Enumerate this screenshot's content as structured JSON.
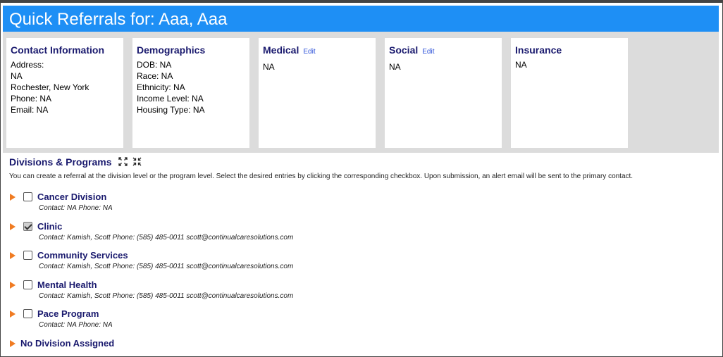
{
  "header": {
    "title": "Quick Referrals for: Aaa, Aaa"
  },
  "cards": {
    "contact": {
      "title": "Contact Information",
      "lines": [
        "Address:",
        "NA",
        "Rochester, New York",
        "Phone: NA",
        "Email: NA"
      ]
    },
    "demographics": {
      "title": "Demographics",
      "lines": [
        "DOB: NA",
        "Race: NA",
        "Ethnicity: NA",
        "Income Level: NA",
        "Housing Type: NA"
      ]
    },
    "medical": {
      "title": "Medical",
      "edit": "Edit",
      "lines": [
        "NA"
      ]
    },
    "social": {
      "title": "Social",
      "edit": "Edit",
      "lines": [
        "NA"
      ]
    },
    "insurance": {
      "title": "Insurance",
      "lines": [
        "NA"
      ]
    }
  },
  "divisions_section": {
    "title": "Divisions & Programs",
    "description": "You can create a referral at the division level or the program level. Select the desired entries by clicking the corresponding checkbox. Upon submission, an alert email will be sent to the primary contact."
  },
  "divisions": [
    {
      "name": "Cancer Division",
      "contact": "Contact: NA Phone: NA",
      "checked": false
    },
    {
      "name": "Clinic",
      "contact": "Contact: Kamish, Scott Phone: (585) 485-0011 scott@continualcaresolutions.com",
      "checked": true
    },
    {
      "name": "Community Services",
      "contact": "Contact: Kamish, Scott Phone: (585) 485-0011 scott@continualcaresolutions.com",
      "checked": false
    },
    {
      "name": "Mental Health",
      "contact": "Contact: Kamish, Scott Phone: (585) 485-0011 scott@continualcaresolutions.com",
      "checked": false
    },
    {
      "name": "Pace Program",
      "contact": "Contact: NA Phone: NA",
      "checked": false
    }
  ],
  "no_division": {
    "name": "No Division Assigned"
  },
  "colors": {
    "title_bar": "#1e8ff5",
    "accent": "#1a1a6e",
    "arrow": "#f07b22",
    "link": "#2a4fd8",
    "band": "#dcdcdc"
  }
}
